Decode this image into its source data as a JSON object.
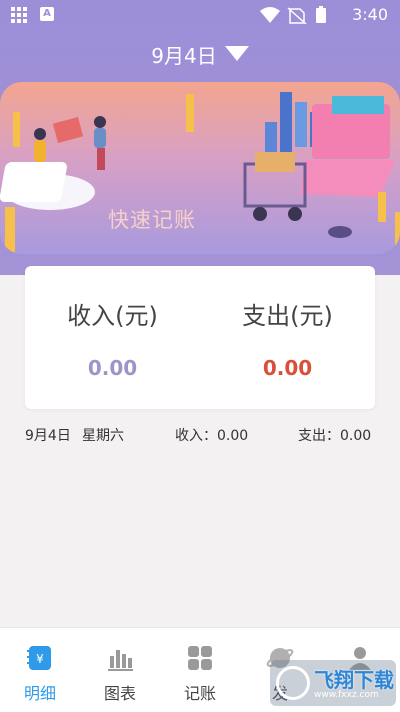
{
  "statusbar": {
    "time": "3:40",
    "app_icon": "A"
  },
  "header": {
    "date": "9月4日"
  },
  "banner": {
    "title": "快速记账"
  },
  "summary_card": {
    "income_label": "收入(元)",
    "income_value": "0.00",
    "expense_label": "支出(元)",
    "expense_value": "0.00",
    "colors": {
      "income": "#9b95c9",
      "expense": "#d8503a"
    }
  },
  "day_row": {
    "date": "9月4日",
    "weekday": "星期六",
    "income": "收入：0.00",
    "expense": "支出：0.00"
  },
  "tabs": [
    {
      "label": "明细",
      "icon": "notebook-icon",
      "active": true
    },
    {
      "label": "图表",
      "icon": "bar-chart-icon",
      "active": false
    },
    {
      "label": "记账",
      "icon": "grid-icon",
      "active": false
    },
    {
      "label": "发",
      "icon": "planet-icon",
      "active": false
    },
    {
      "label": "",
      "icon": "user-icon",
      "active": false
    }
  ],
  "watermark": {
    "title": "飞翔下载",
    "url": "www.fxxz.com"
  }
}
